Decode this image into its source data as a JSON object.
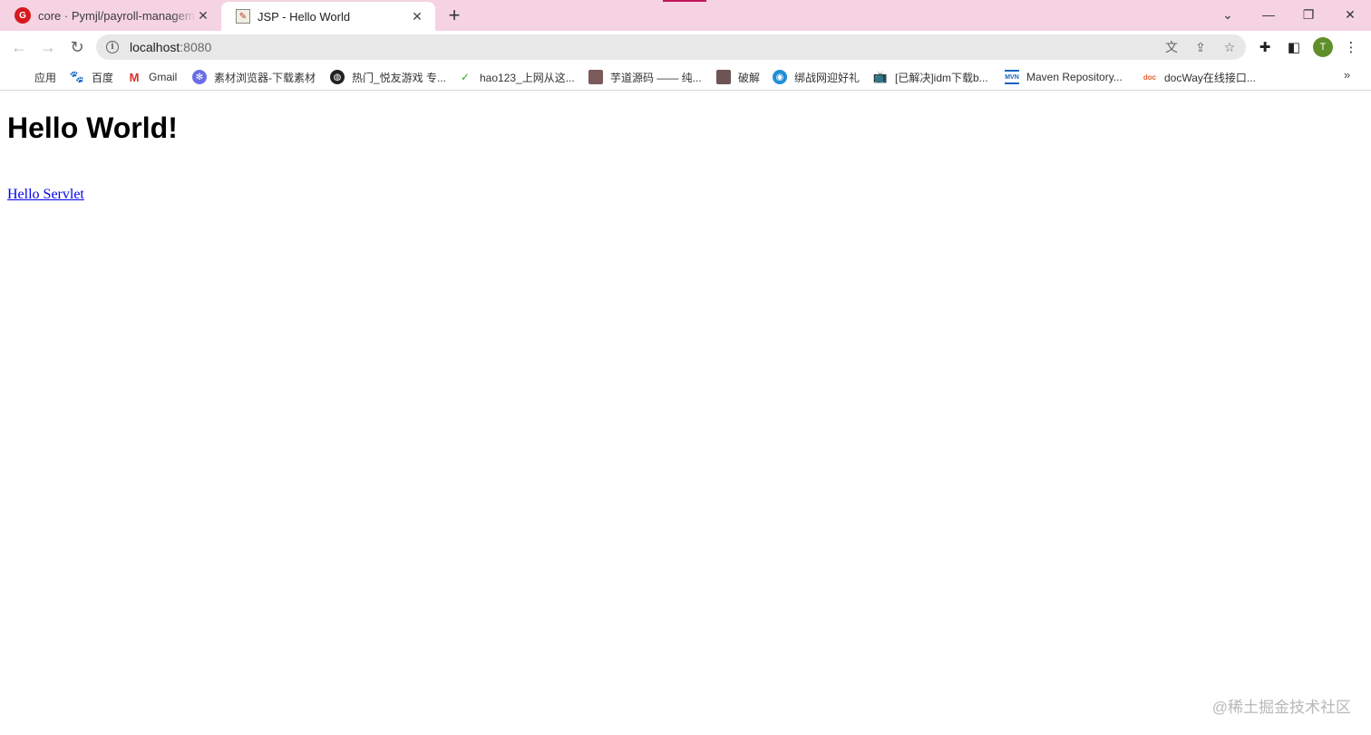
{
  "browser": {
    "tabs": [
      {
        "title": "core · Pymjl/payroll-managem",
        "favicon": "gitee-icon",
        "active": false
      },
      {
        "title": "JSP - Hello World",
        "favicon": "jsp-page-icon",
        "active": true
      }
    ],
    "address": {
      "host": "localhost",
      "port": ":8080"
    },
    "avatar_letter": "T"
  },
  "bookmarks": [
    {
      "label": "应用",
      "icon": "apps-grid-icon"
    },
    {
      "label": "百度",
      "icon": "baidu-paw-icon"
    },
    {
      "label": "Gmail",
      "icon": "gmail-icon"
    },
    {
      "label": "素材浏览器-下载素材",
      "icon": "snowflake-icon"
    },
    {
      "label": "热门_悦友游戏 专...",
      "icon": "globe-icon"
    },
    {
      "label": "hao123_上网从这...",
      "icon": "hao123-icon"
    },
    {
      "label": "芋道源码 —— 纯...",
      "icon": "avatar-thumb-icon"
    },
    {
      "label": "破解",
      "icon": "avatar-thumb-icon"
    },
    {
      "label": "绑战网迎好礼",
      "icon": "battlenet-icon"
    },
    {
      "label": "[已解决]idm下载b...",
      "icon": "bilibili-icon"
    },
    {
      "label": "Maven Repository...",
      "icon": "mvn-icon"
    },
    {
      "label": "docWay在线接口...",
      "icon": "doc-icon"
    }
  ],
  "page": {
    "heading": "Hello World!",
    "link": "Hello Servlet"
  },
  "watermark": "@稀土掘金技术社区",
  "colors": {
    "tabstrip": "#f5d3e3",
    "link": "#0000ee",
    "avatar": "#5f8f2a"
  }
}
